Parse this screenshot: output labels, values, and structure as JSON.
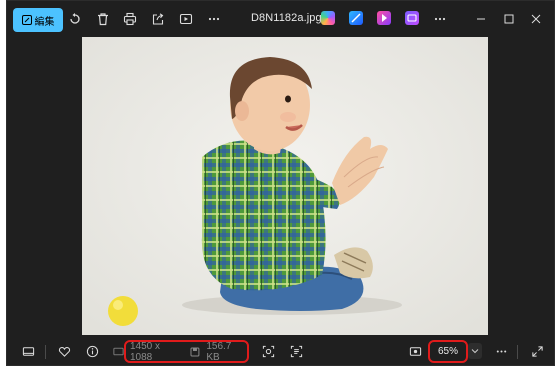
{
  "toolbar": {
    "edit_label": "編集",
    "filename": "D8N1182a.jpg",
    "icons": [
      "rotate-icon",
      "delete-icon",
      "print-icon",
      "share-icon",
      "slideshow-icon",
      "more-icon"
    ],
    "app_icons": [
      "copilot-icon",
      "designer-icon",
      "clipchamp-icon",
      "app-icon",
      "more-icon"
    ]
  },
  "window_controls": [
    "minimize-icon",
    "maximize-icon",
    "close-icon"
  ],
  "bottombar": {
    "dimensions": "1450 x 1088",
    "filesize": "156.7 KB",
    "zoom": "65%",
    "icons": [
      "filmstrip-icon",
      "favorite-icon",
      "info-icon",
      "visual-search-icon",
      "text-extract-icon",
      "fit-icon",
      "more-icon",
      "fullscreen-icon"
    ]
  },
  "colors": {
    "accent": "#4cc2ff",
    "window_bg": "#1f1f1f",
    "highlight_border": "#e01b1b"
  }
}
